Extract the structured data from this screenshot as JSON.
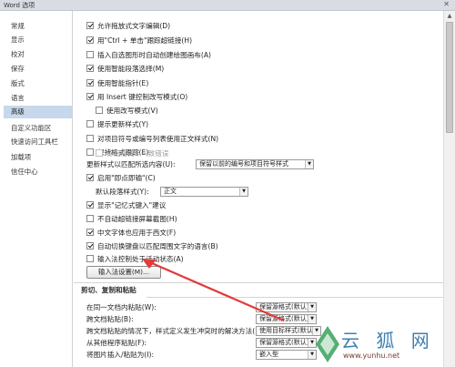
{
  "window": {
    "title": "Word 选项",
    "close_glyph": "✕"
  },
  "sidebar": {
    "items": [
      {
        "label": "常规"
      },
      {
        "label": "显示"
      },
      {
        "label": "校对"
      },
      {
        "label": "保存"
      },
      {
        "label": "版式"
      },
      {
        "label": "语言"
      },
      {
        "label": "高级",
        "active": true
      },
      {
        "label": "自定义功能区"
      },
      {
        "label": "快速访问工具栏"
      },
      {
        "label": "加载项"
      },
      {
        "label": "信任中心"
      }
    ]
  },
  "options": [
    {
      "label": "允许拖放式文字编辑(D)",
      "checked": true
    },
    {
      "label": "用\"Ctrl + 单击\"跟踪超链接(H)",
      "checked": true
    },
    {
      "label": "插入自选图形时自动创建绘图画布(A)",
      "checked": false
    },
    {
      "label": "使用智能段落选择(M)",
      "checked": true
    },
    {
      "label": "使用智能指针(E)",
      "checked": true
    },
    {
      "label": "用 Insert 键控制改写模式(O)",
      "checked": true
    },
    {
      "label": "使用改写模式(V)",
      "checked": false,
      "indent": true
    },
    {
      "label": "提示更新样式(Y)",
      "checked": false
    },
    {
      "label": "对项目符号或编号列表使用正文样式(N)",
      "checked": false
    },
    {
      "label": "保持格式跟踪(E)",
      "checked": false
    },
    {
      "label": "标记格式不一致错误",
      "checked": false,
      "indent": true,
      "disabled": true
    }
  ],
  "style_update": {
    "label": "更新样式以匹配所选内容(U):",
    "value": "保留以前的编号和项目符号样式"
  },
  "click_and_type": {
    "label": "启用\"即点即输\"(C)",
    "checked": true
  },
  "default_para_style": {
    "label": "默认段落样式(Y):",
    "value": "正文"
  },
  "options2": [
    {
      "label": "显示\"记忆式键入\"建议",
      "checked": true
    },
    {
      "label": "不自动超链接屏幕截图(H)",
      "checked": false
    },
    {
      "label": "中文字体也应用于西文(F)",
      "checked": true
    },
    {
      "label": "自动切换键盘以匹配周围文字的语言(B)",
      "checked": true
    },
    {
      "label": "输入法控制处于活动状态(A)",
      "checked": false
    }
  ],
  "ime_button": {
    "label": "输入法设置(M)..."
  },
  "section_cut_copy": {
    "title": "剪切、复制和粘贴"
  },
  "paste_options": [
    {
      "label": "在同一文档内粘贴(W):",
      "value": "保留源格式(默认)"
    },
    {
      "label": "跨文档粘贴(B):",
      "value": "保留源格式(默认)"
    },
    {
      "label": "跨文档粘贴的情况下，样式定义发生冲突时的解决方法(E):",
      "value": "使用目标样式(默认)"
    },
    {
      "label": "从其他程序粘贴(F):",
      "value": "保留源格式(默认)"
    },
    {
      "label": "将图片插入/粘贴为(I):",
      "value": "嵌入型"
    }
  ],
  "watermark": {
    "text": "云 狐 网",
    "url": "www.yunhu.net"
  },
  "colors": {
    "selected_nav": "#c7d8ec",
    "annotation_arrow": "#e23b3b",
    "watermark_blue": "#3f7fb0"
  }
}
